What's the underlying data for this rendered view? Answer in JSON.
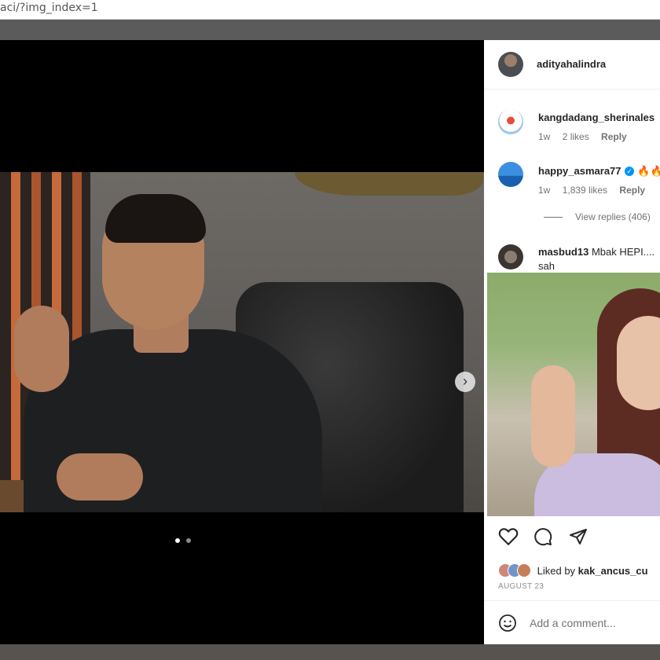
{
  "browser": {
    "url_fragment": "aci/?img_index=1"
  },
  "post": {
    "author": "adityahalindra",
    "carousel": {
      "current_slide": 1,
      "total_slides": 2
    }
  },
  "comments": [
    {
      "username": "kangdadang_sherinales",
      "text": "",
      "time": "1w",
      "likes": "2 likes",
      "reply": "Reply"
    },
    {
      "username": "happy_asmara77",
      "verified": true,
      "text": "🔥🔥",
      "time": "1w",
      "likes": "1,839 likes",
      "reply": "Reply",
      "view_replies": "View replies (406)"
    },
    {
      "username": "masbud13",
      "text": "Mbak HEPI....",
      "text_line2": "sah"
    }
  ],
  "footer": {
    "liked_by": "Liked by",
    "liked_by_user": "kak_ancus_cu",
    "date": "AUGUST 23",
    "add_comment_placeholder": "Add a comment..."
  },
  "colors": {
    "panel_bg": "#ffffff",
    "text": "#262626",
    "muted": "#737373",
    "verified": "#0095f6"
  },
  "icons": [
    "heart-icon",
    "comment-icon",
    "share-icon",
    "emoji-icon",
    "chevron-right-icon"
  ]
}
